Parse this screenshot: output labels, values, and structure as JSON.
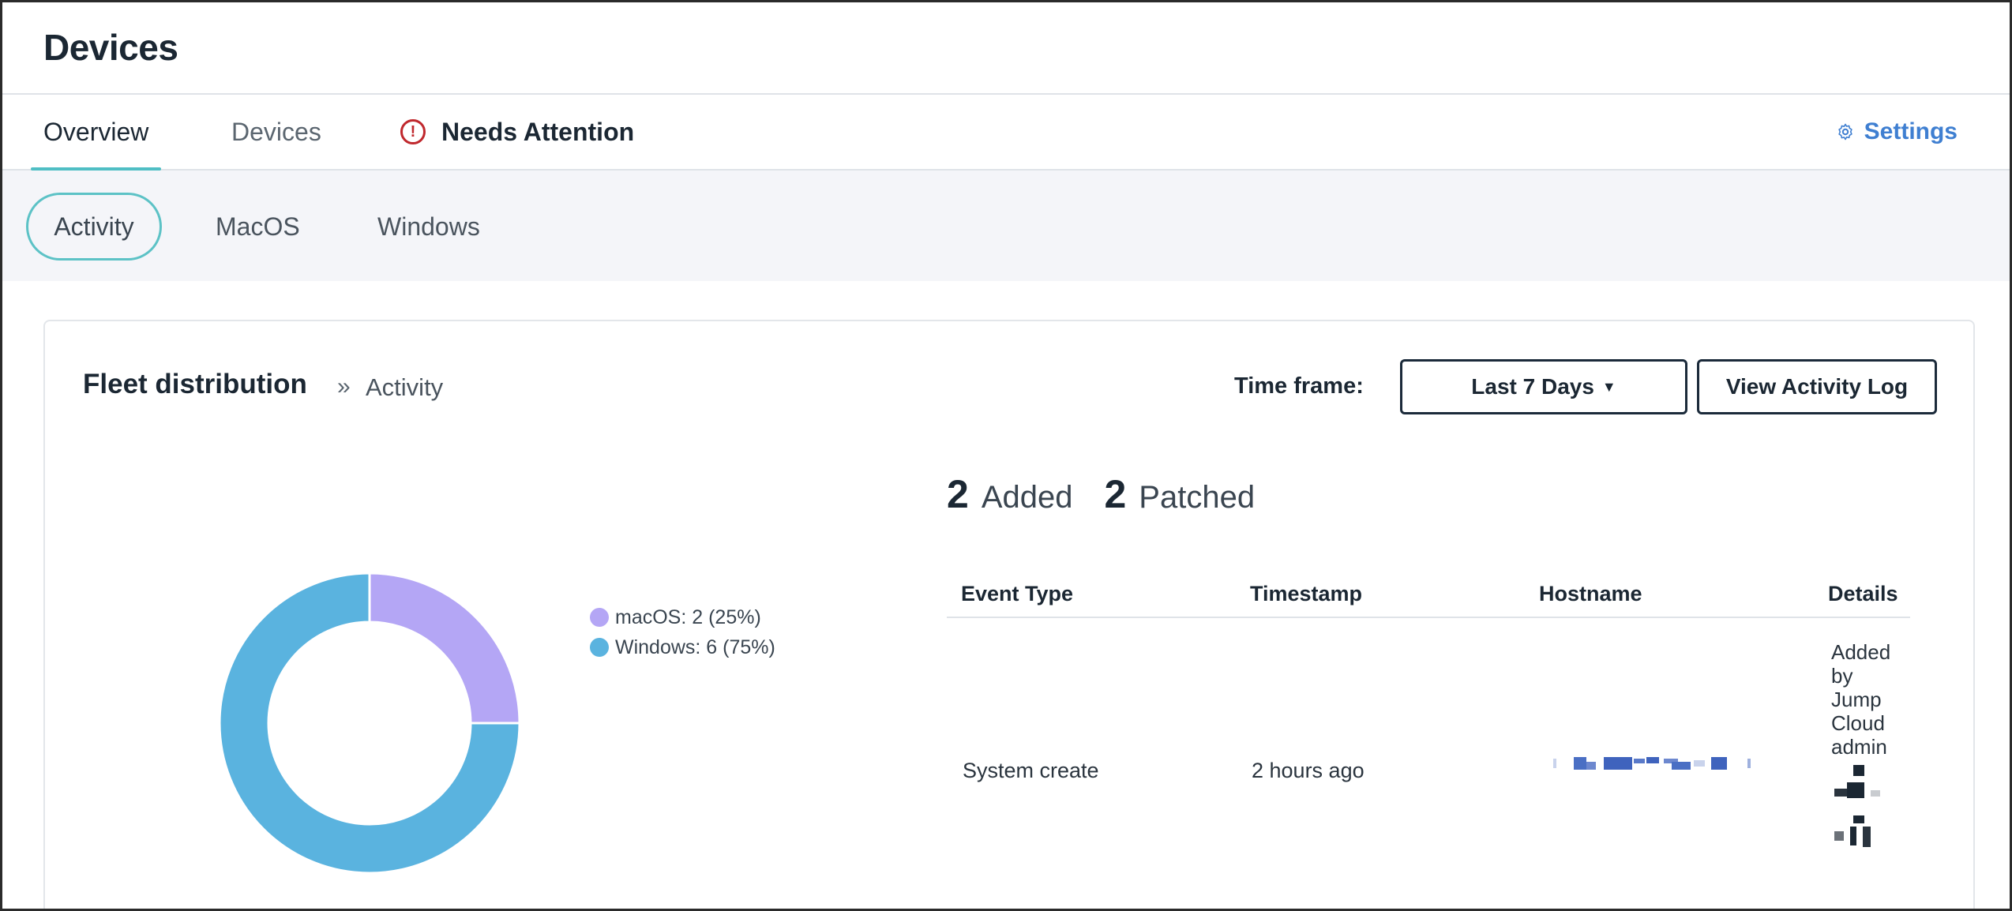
{
  "header": {
    "title": "Devices"
  },
  "tabs": {
    "overview": "Overview",
    "devices": "Devices",
    "needs_attention": "Needs Attention",
    "settings": "Settings"
  },
  "subnav": {
    "activity": "Activity",
    "macos": "MacOS",
    "windows": "Windows"
  },
  "card": {
    "title": "Fleet distribution",
    "breadcrumb_sep": "»",
    "breadcrumb": "Activity",
    "timeframe_label": "Time frame:",
    "timeframe_value": "Last 7 Days",
    "view_log_label": "View Activity Log"
  },
  "chart_data": {
    "type": "pie",
    "categories": [
      "macOS",
      "Windows"
    ],
    "values": [
      2,
      6
    ],
    "percent": [
      25,
      75
    ],
    "legend_labels": [
      "macOS: 2 (25%)",
      "Windows: 6 (75%)"
    ],
    "colors": [
      "#b4a6f5",
      "#5ab3df"
    ],
    "legend": "right"
  },
  "summary": {
    "added_count": "2",
    "added_label": "Added",
    "patched_count": "2",
    "patched_label": "Patched"
  },
  "table": {
    "columns": [
      "Event Type",
      "Timestamp",
      "Hostname",
      "Details"
    ],
    "rows": [
      {
        "event_type": "System create",
        "timestamp": "2 hours ago",
        "hostname": "",
        "details": "Added by Jump Cloud admin"
      }
    ]
  },
  "colors": {
    "accent": "#4fbec4",
    "link": "#3f7fd1",
    "alert": "#c0282d",
    "dark": "#1b2733"
  }
}
